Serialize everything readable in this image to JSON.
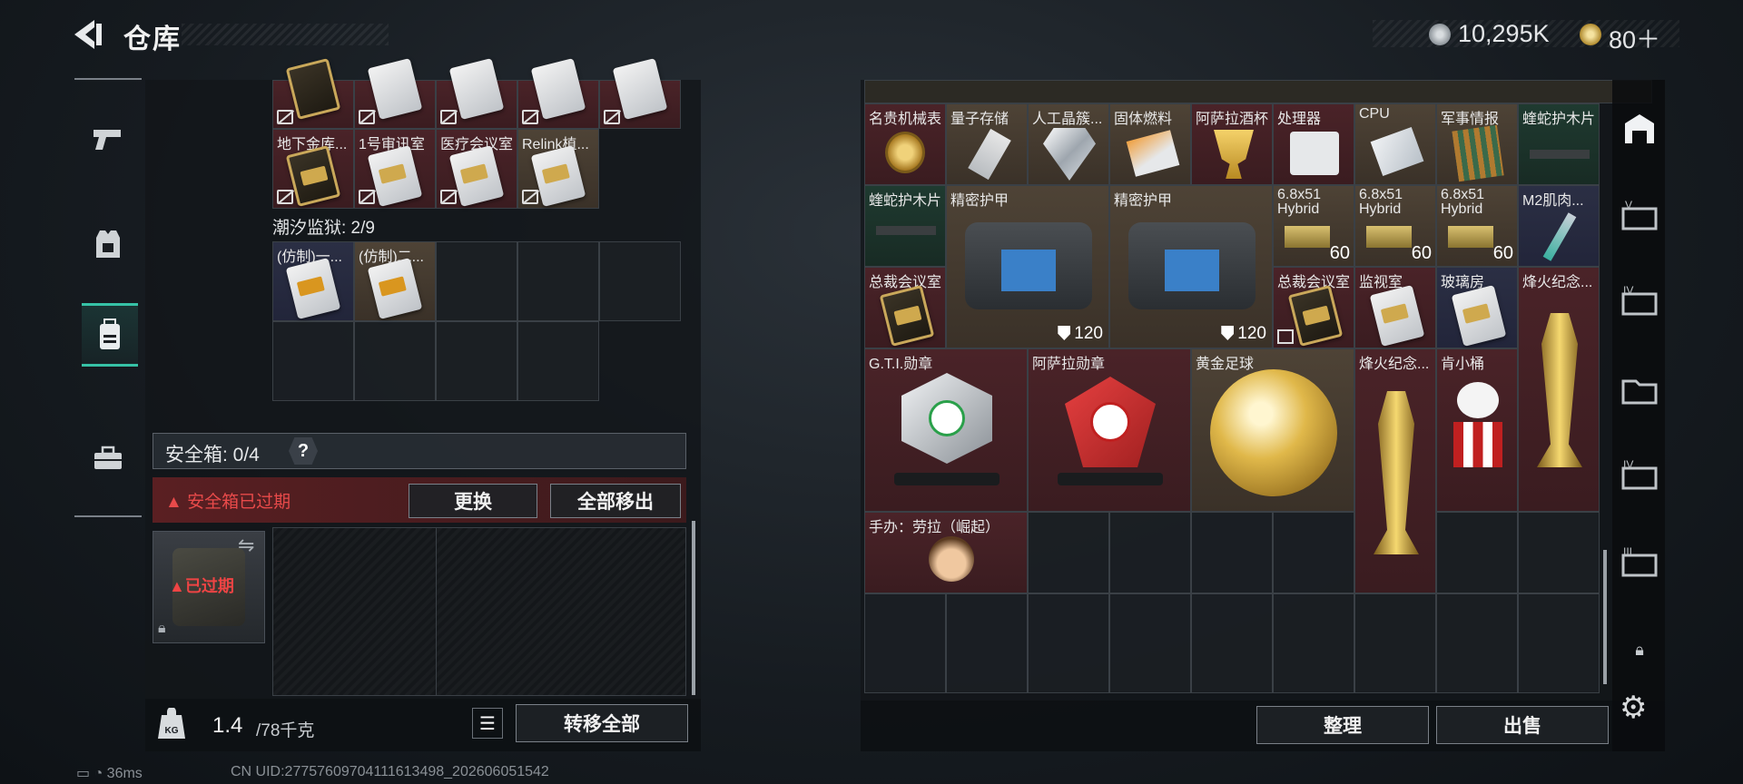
{
  "header": {
    "title": "仓库"
  },
  "currency": {
    "silver": "10,295K",
    "gold": "80＋"
  },
  "nav": {
    "items": [
      "weapons",
      "armor",
      "backpack",
      "toolbox"
    ]
  },
  "left": {
    "row_top": [
      {
        "label": "",
        "style": "red"
      },
      {
        "label": "",
        "style": "red"
      },
      {
        "label": "",
        "style": "red"
      },
      {
        "label": "",
        "style": "red"
      },
      {
        "label": "",
        "style": "red"
      }
    ],
    "row_keys": [
      {
        "label": "地下金库...",
        "style": "red",
        "card": "gold"
      },
      {
        "label": "1号审讯室",
        "style": "red",
        "card": "white"
      },
      {
        "label": "医疗会议室",
        "style": "red",
        "card": "white"
      },
      {
        "label": "Relink植...",
        "style": "tan",
        "card": "white"
      }
    ],
    "prison_label": "潮汐监狱: 2/9",
    "prison_keys": [
      {
        "label": "(仿制)一...",
        "style": "blue",
        "card": "white"
      },
      {
        "label": "(仿制)二...",
        "style": "tan",
        "card": "copy"
      }
    ],
    "safe_label": "安全箱: 0/4",
    "help": "?",
    "expired_msg": "安全箱已过期",
    "btn_replace": "更换",
    "btn_moveall": "全部移出",
    "safebox_expired": "已过期",
    "weight_current": "1.4",
    "weight_max": "/78千克",
    "btn_transfer": "转移全部"
  },
  "right": {
    "row1": [
      {
        "label": "名贵机械表",
        "style": "red"
      },
      {
        "label": "量子存储",
        "style": "tan"
      },
      {
        "label": "人工晶簇...",
        "style": "tan"
      },
      {
        "label": "固体燃料",
        "style": "tan"
      },
      {
        "label": "阿萨拉酒杯",
        "style": "red"
      },
      {
        "label": "处理器",
        "style": "red"
      },
      {
        "label": "CPU",
        "style": "tan"
      },
      {
        "label": "军事情报",
        "style": "tan"
      },
      {
        "label": "蝰蛇护木片",
        "style": "green"
      }
    ],
    "row2": [
      {
        "label": "蝰蛇护木片",
        "style": "green"
      },
      {
        "label": "精密护甲",
        "armor": "120"
      },
      {
        "label": "精密护甲",
        "armor": "120"
      },
      {
        "label": "6.8x51 Hybrid",
        "qty": "60"
      },
      {
        "label": "6.8x51 Hybrid",
        "qty": "60"
      },
      {
        "label": "6.8x51 Hybrid",
        "qty": "60"
      },
      {
        "label": "M2肌肉...",
        "style": "blue"
      }
    ],
    "row3": [
      {
        "label": "总裁会议室"
      },
      {
        "label": "总裁会议室"
      },
      {
        "label": "监视室"
      },
      {
        "label": "玻璃房"
      },
      {
        "label": "烽火纪念..."
      }
    ],
    "row4": [
      {
        "label": "G.T.I.勋章"
      },
      {
        "label": "阿萨拉勋章"
      },
      {
        "label": "黄金足球"
      },
      {
        "label": "烽火纪念..."
      },
      {
        "label": "肯小桶"
      }
    ],
    "row5": [
      {
        "label": "手办：劳拉（崛起）"
      }
    ],
    "btn_sort": "整理",
    "btn_sell": "出售"
  },
  "status": {
    "ping": "36ms",
    "uid": "CN UID:27757609704111613498_202606051542"
  }
}
